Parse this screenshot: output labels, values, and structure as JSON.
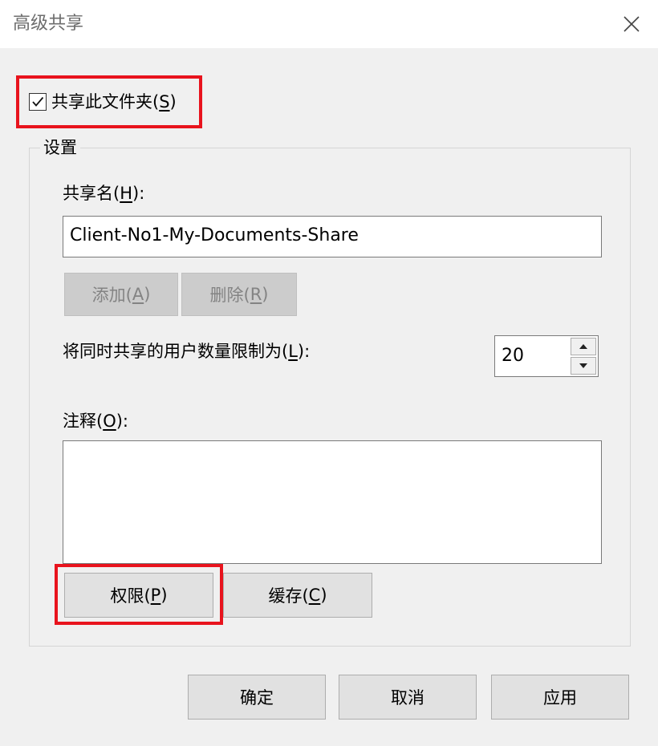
{
  "window": {
    "title": "高级共享",
    "close_icon": "close-icon"
  },
  "share_checkbox": {
    "checked": true,
    "label_prefix": "共享此文件夹(",
    "label_key": "S",
    "label_suffix": ")"
  },
  "settings": {
    "legend": "设置",
    "share_name": {
      "label_prefix": "共享名(",
      "label_key": "H",
      "label_suffix": "):",
      "value": "Client-No1-My-Documents-Share"
    },
    "add_button": {
      "label_prefix": "添加(",
      "label_key": "A",
      "label_suffix": ")"
    },
    "remove_button": {
      "label_prefix": "删除(",
      "label_key": "R",
      "label_suffix": ")"
    },
    "user_limit": {
      "label_prefix": "将同时共享的用户数量限制为(",
      "label_key": "L",
      "label_suffix": "):",
      "value": "20"
    },
    "comment": {
      "label_prefix": "注释(",
      "label_key": "O",
      "label_suffix": "):",
      "value": ""
    },
    "permissions_button": {
      "label_prefix": "权限(",
      "label_key": "P",
      "label_suffix": ")"
    },
    "caching_button": {
      "label_prefix": "缓存(",
      "label_key": "C",
      "label_suffix": ")"
    }
  },
  "footer": {
    "ok": "确定",
    "cancel": "取消",
    "apply": "应用"
  },
  "colors": {
    "highlight": "#e8131d",
    "window_bg": "#f0f0f0",
    "button_bg": "#e1e1e1"
  }
}
